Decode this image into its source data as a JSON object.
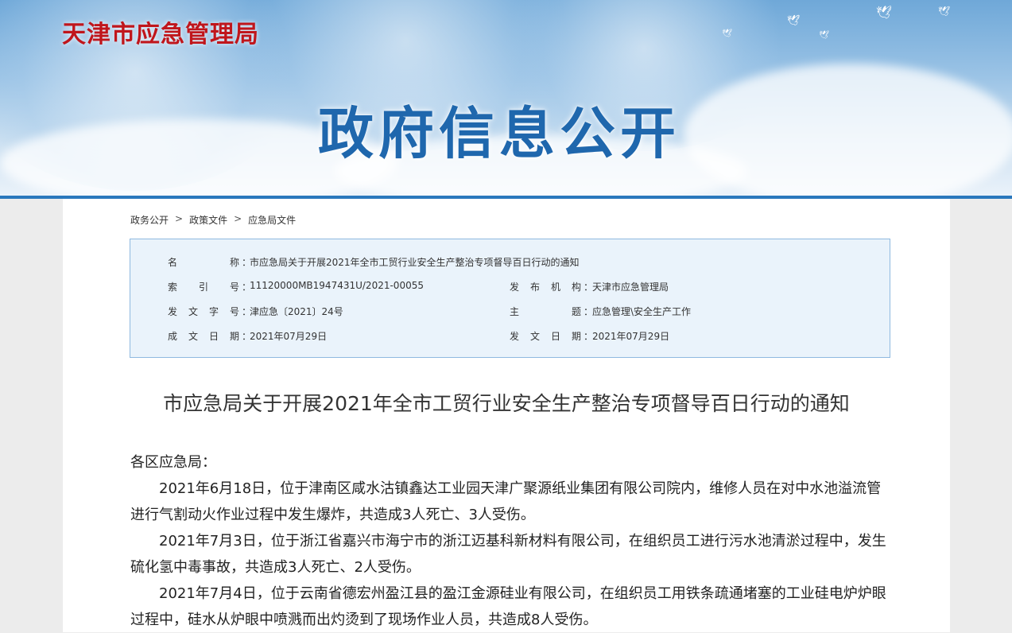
{
  "header": {
    "site_name": "天津市应急管理局",
    "section_title": "政府信息公开"
  },
  "breadcrumb": {
    "items": [
      "政务公开",
      "政策文件",
      "应急局文件"
    ],
    "separator": ">"
  },
  "meta": {
    "name_label": "名 称",
    "name_value": "市应急局关于开展2021年全市工贸行业安全生产整治专项督导百日行动的通知",
    "index_label": "索 引 号",
    "index_value": "11120000MB1947431U/2021-00055",
    "publisher_label": "发 布 机 构",
    "publisher_value": "天津市应急管理局",
    "docno_label": "发 文 字 号",
    "docno_value": "津应急〔2021〕24号",
    "subject_label": "主 题",
    "subject_value": "应急管理\\安全生产工作",
    "created_label": "成 文 日 期",
    "created_value": "2021年07月29日",
    "published_label": "发 文 日 期",
    "published_value": "2021年07月29日",
    "colon": "："
  },
  "document": {
    "title": "市应急局关于开展2021年全市工贸行业安全生产整治专项督导百日行动的通知",
    "salutation": "各区应急局：",
    "paragraphs": [
      "2021年6月18日，位于津南区咸水沽镇鑫达工业园天津广聚源纸业集团有限公司院内，维修人员在对中水池溢流管进行气割动火作业过程中发生爆炸，共造成3人死亡、3人受伤。",
      "2021年7月3日，位于浙江省嘉兴市海宁市的浙江迈基科新材料有限公司，在组织员工进行污水池清淤过程中，发生硫化氢中毒事故，共造成3人死亡、2人受伤。",
      "2021年7月4日，位于云南省德宏州盈江县的盈江金源硅业有限公司，在组织员工用铁条疏通堵塞的工业硅电炉炉眼过程中，硅水从炉眼中喷溅而出灼烫到了现场作业人员，共造成8人受伤。"
    ]
  },
  "colors": {
    "site_name": "#c0161c",
    "section_title": "#1f67ad",
    "meta_bg": "#eaf3fb",
    "meta_border": "#8fb9e0"
  }
}
